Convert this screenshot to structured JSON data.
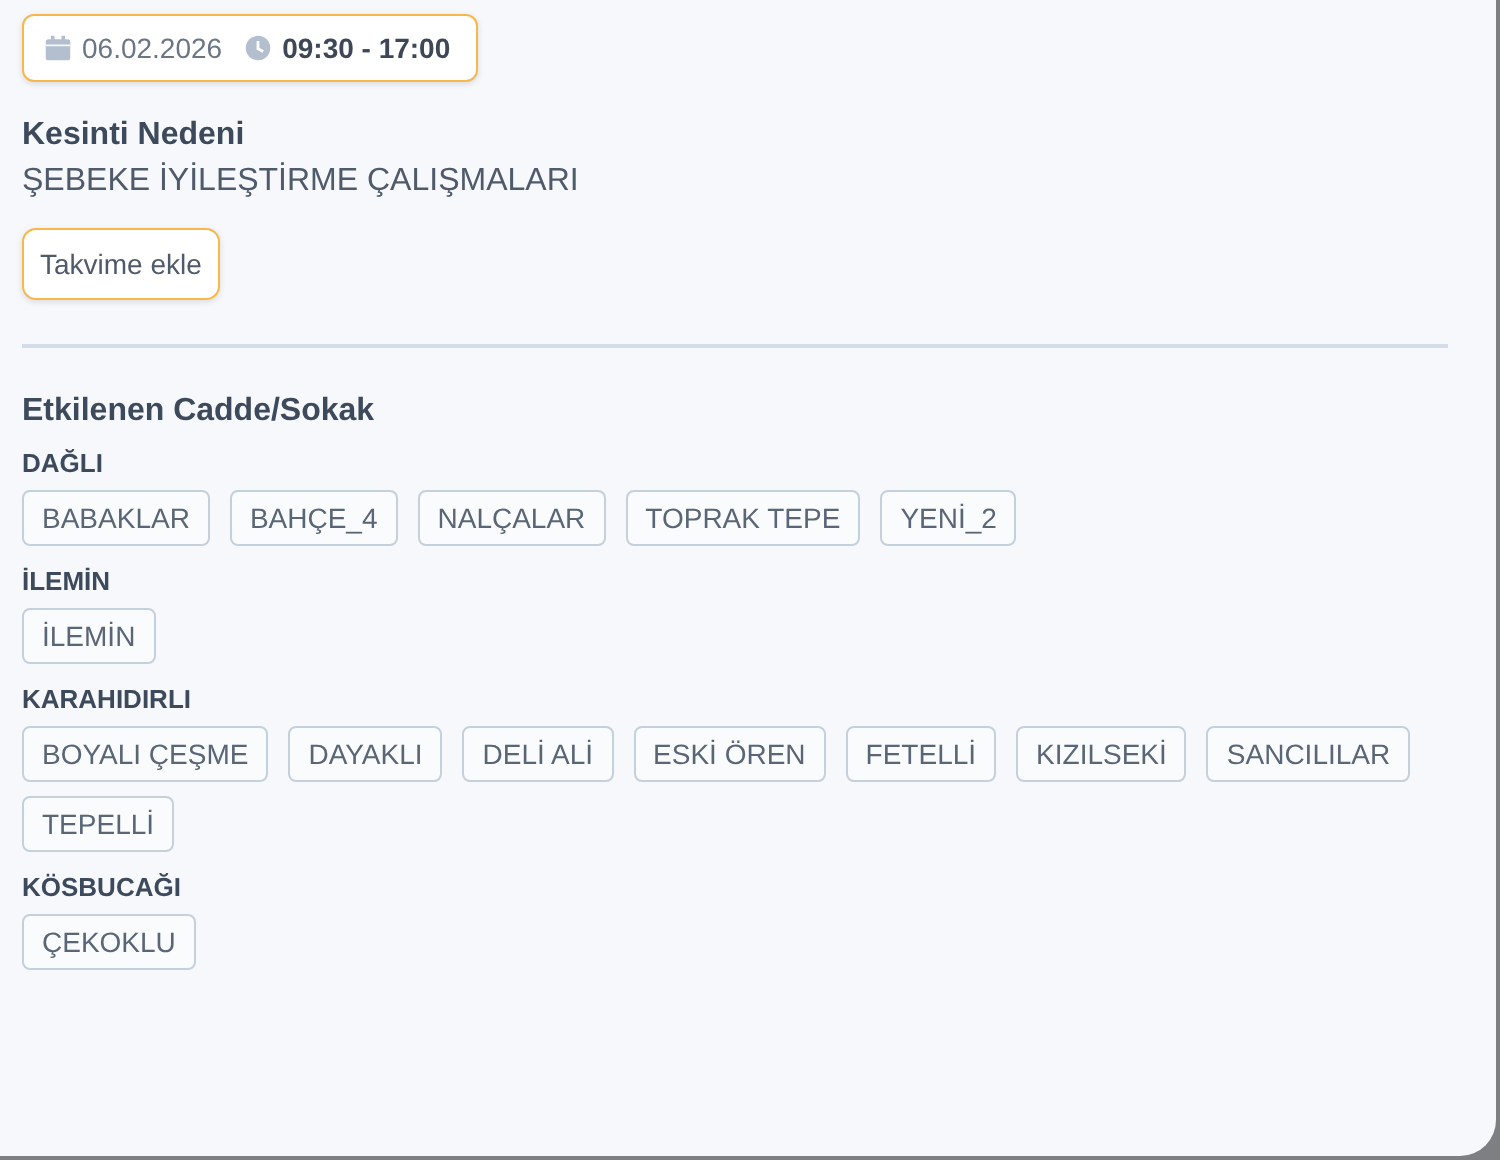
{
  "schedule": {
    "date": "06.02.2026",
    "time": "09:30 - 17:00"
  },
  "reason": {
    "label": "Kesinti Nedeni",
    "value": "ŞEBEKE İYİLEŞTİRME ÇALIŞMALARI"
  },
  "calendar_button": "Takvime ekle",
  "streets": {
    "title": "Etkilenen Cadde/Sokak",
    "groups": [
      {
        "name": "DAĞLI",
        "items": [
          "BABAKLAR",
          "BAHÇE_4",
          "NALÇALAR",
          "TOPRAK TEPE",
          "YENİ_2"
        ]
      },
      {
        "name": "İLEMİN",
        "items": [
          "İLEMİN"
        ]
      },
      {
        "name": "KARAHIDIRLI",
        "items": [
          "BOYALI ÇEŞME",
          "DAYAKLI",
          "DELİ ALİ",
          "ESKİ ÖREN",
          "FETELLİ",
          "KIZILSEKİ",
          "SANCILILAR",
          "TEPELLİ"
        ]
      },
      {
        "name": "KÖSBUCAĞI",
        "items": [
          "ÇEKOKLU"
        ]
      }
    ]
  }
}
